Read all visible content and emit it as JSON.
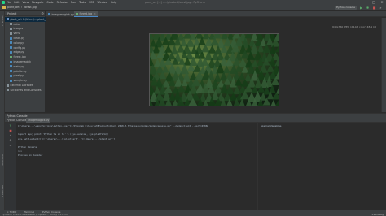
{
  "window": {
    "title": "plant_art [...] - ...\\pixelart\\forest.jpg - PyCharm"
  },
  "menu": [
    "File",
    "Edit",
    "View",
    "Navigate",
    "Code",
    "Refactor",
    "Run",
    "Tools",
    "VCS",
    "Window",
    "Help"
  ],
  "breadcrumb": {
    "project": "plant_art",
    "file": "forest.jpg"
  },
  "toolbar": {
    "run_config": "Python console"
  },
  "project_panel": {
    "title": "Project"
  },
  "tree": [
    {
      "label": "plant_art C:\\Users\\...\\plant_art",
      "type": "folder-blue",
      "indent": 0,
      "selected": true
    },
    {
      "label": "data",
      "type": "folder",
      "indent": 1
    },
    {
      "label": "images",
      "type": "folder",
      "indent": 1
    },
    {
      "label": "venv",
      "type": "folder",
      "indent": 1
    },
    {
      "label": "clean.py",
      "type": "py",
      "indent": 1
    },
    {
      "label": "color.py",
      "type": "py",
      "indent": 1
    },
    {
      "label": "config.py",
      "type": "py",
      "indent": 1
    },
    {
      "label": "edge.py",
      "type": "py",
      "indent": 1
    },
    {
      "label": "forest.jpg",
      "type": "img",
      "indent": 1
    },
    {
      "label": "imagemagick",
      "type": "py",
      "indent": 1
    },
    {
      "label": "main.py",
      "type": "py",
      "indent": 1
    },
    {
      "label": "palette.py",
      "type": "py",
      "indent": 1
    },
    {
      "label": "pixel.py",
      "type": "py",
      "indent": 1
    },
    {
      "label": "sample.py",
      "type": "py",
      "indent": 1
    },
    {
      "label": "External Libraries",
      "type": "folder",
      "indent": 0
    },
    {
      "label": "Scratches and Consoles",
      "type": "folder",
      "indent": 0
    }
  ],
  "editor_tabs": [
    {
      "label": "imagemagick.py",
      "icon": "py"
    },
    {
      "label": "forest.jpg",
      "icon": "img",
      "active": true
    }
  ],
  "image_info": "640x360 JPEG (24-bit color) 48.1 kB",
  "bottom_panel": {
    "title": "Python Console"
  },
  "console_tabs": [
    {
      "label": "Python Console",
      "active": false
    },
    {
      "label": "imagemagick.py",
      "active": true
    }
  ],
  "console_lines": [
    {
      "text": "C:\\Users\\...\\venv\\Scripts\\python.exe \"C:/Program Files/JetBrains/PyCharm 2018.3.3/helpers/pydev/pydevconsole.py\" --mode=client --port=49868",
      "color": "#a9b7c6"
    },
    {
      "text": "",
      "color": "#a9b7c6"
    },
    {
      "text": "import sys; print('Python %s on %s' % (sys.version, sys.platform))",
      "color": "#a9b7c6"
    },
    {
      "text": "sys.path.extend(['C:\\\\Users\\\\...\\\\plant_art', 'C:/Users/.../plant_art'])",
      "color": "#a9b7c6"
    },
    {
      "text": "",
      "color": "#a9b7c6"
    },
    {
      "text": "Python Console",
      "color": "#a9b7c6"
    },
    {
      "text": ">>> ",
      "color": "#a9b7c6"
    },
    {
      "text": "Process on Decoder",
      "color": "#a9b7c6"
    }
  ],
  "special_vars": {
    "label": "Special Variables"
  },
  "bottom_tools": [
    "6: TODO",
    "Terminal",
    "Python Console"
  ],
  "status": {
    "message": "PyCharm 2018.3.4 available // Update... (today 1:13 PM)",
    "event_log": "Event Log"
  }
}
